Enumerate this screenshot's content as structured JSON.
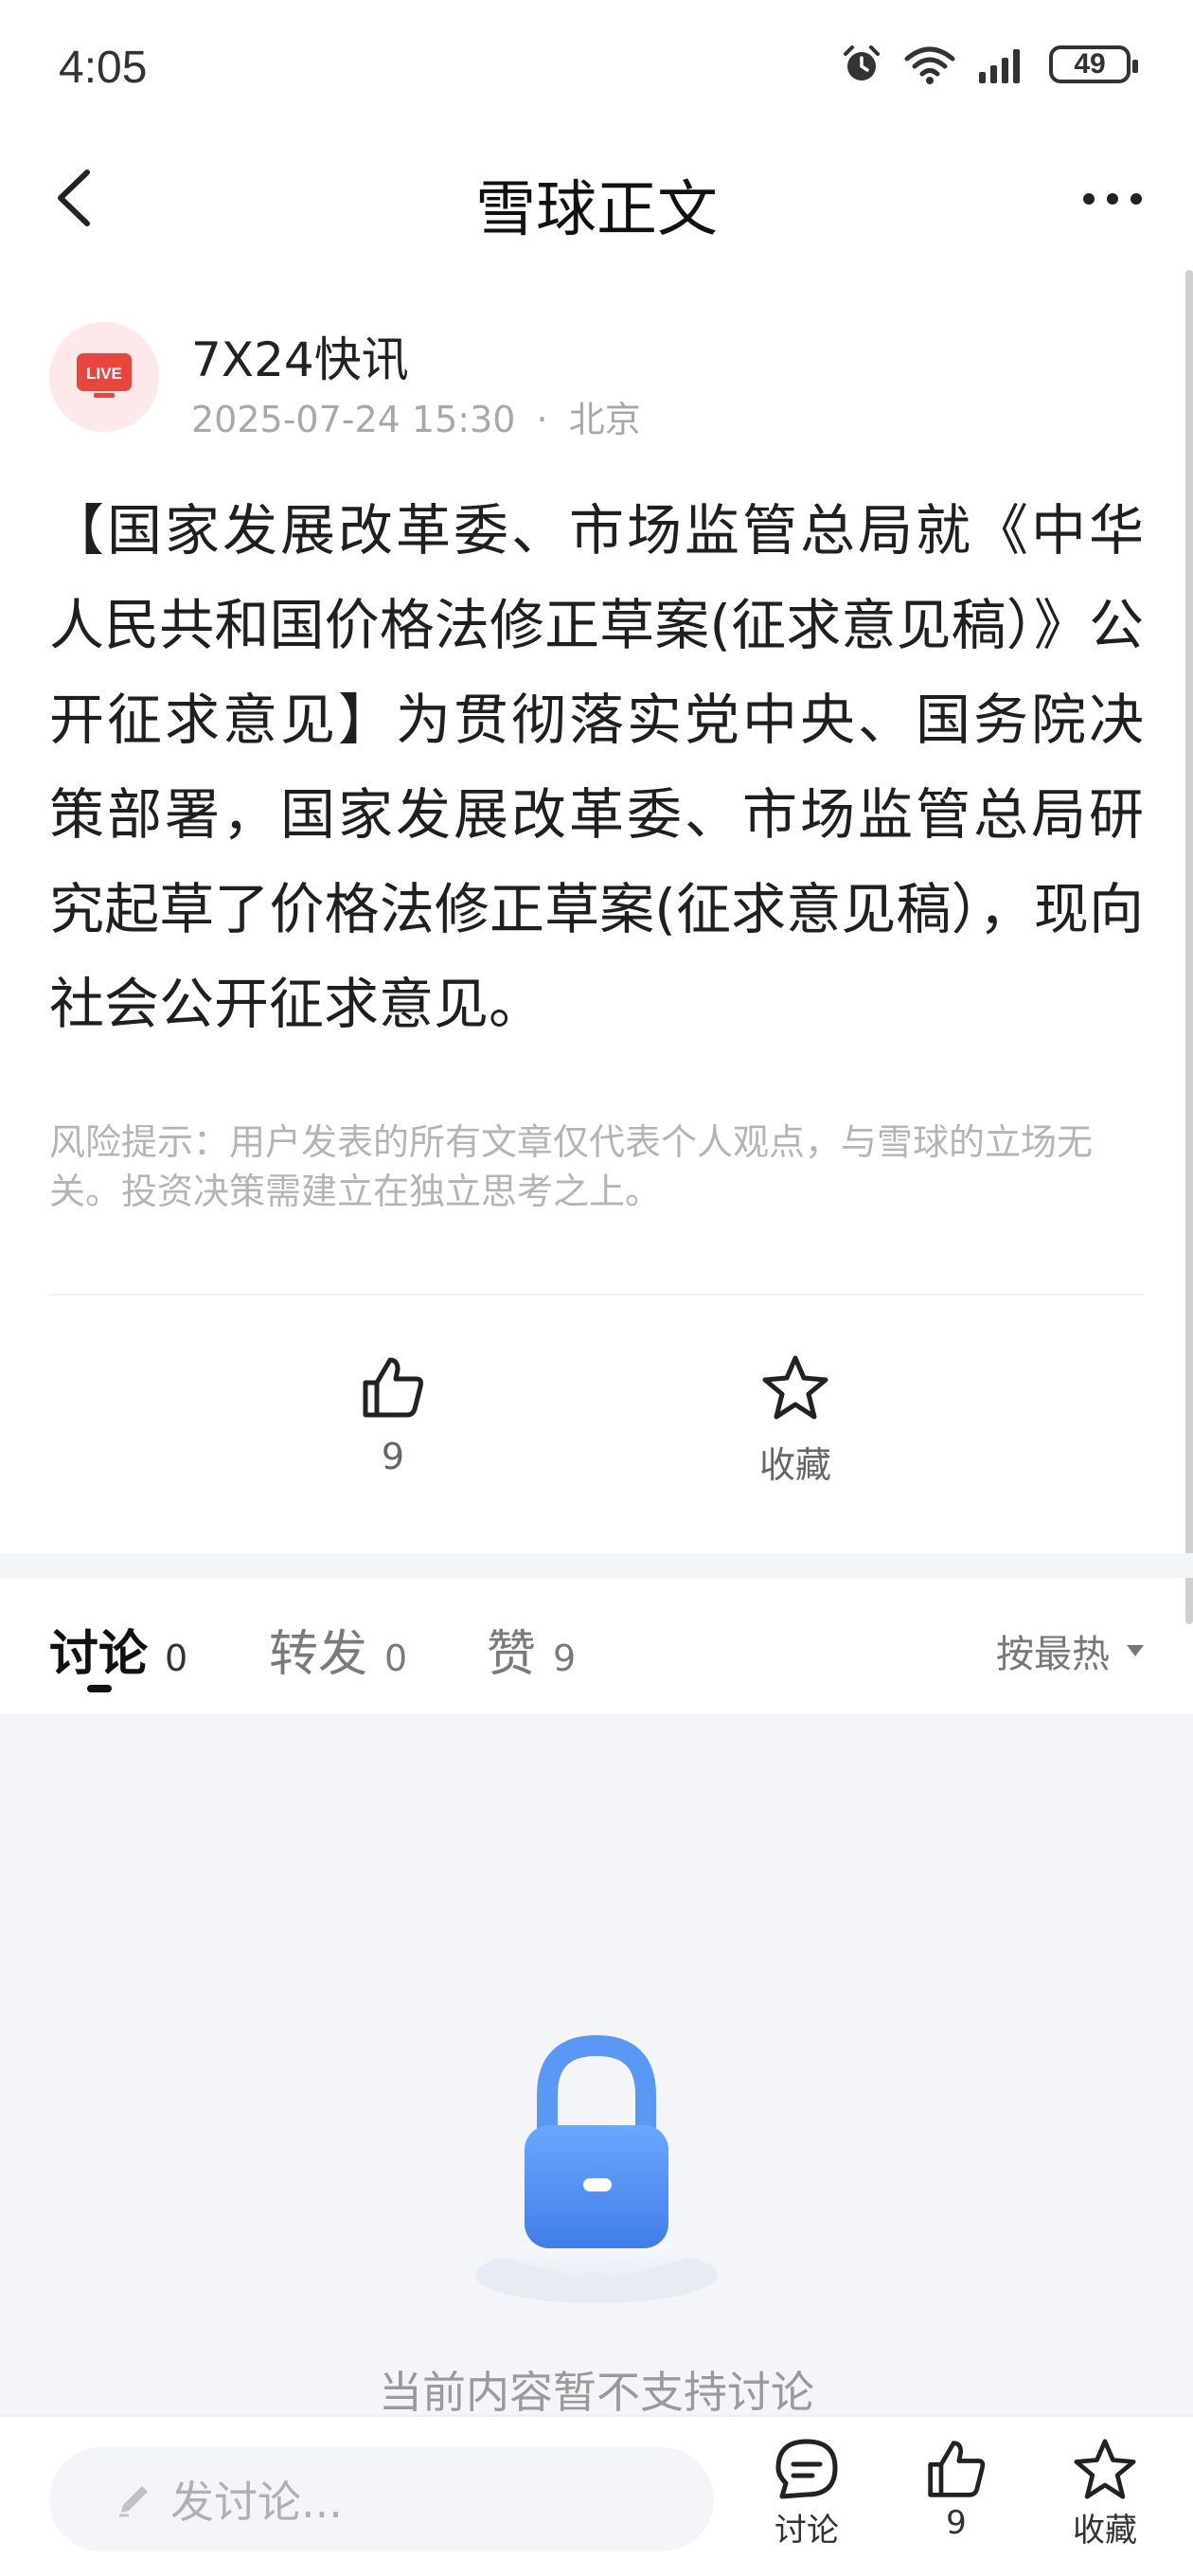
{
  "status_bar": {
    "time": "4:05",
    "battery": "49",
    "icons": [
      "alarm-icon",
      "wifi-icon",
      "signal-icon",
      "battery-icon"
    ]
  },
  "nav": {
    "title": "雪球正文",
    "back_icon": "back-arrow-icon",
    "more_icon": "more-icon"
  },
  "author": {
    "avatar_text": "LIVE",
    "name": "7X24快讯",
    "date": "2025-07-24 15:30",
    "separator": "·",
    "location": "北京"
  },
  "article": {
    "body": "【国家发展改革委、市场监管总局就《中华人民共和国价格法修正草案(征求意见稿）》公开征求意见】为贯彻落实党中央、国务院决策部署，国家发展改革委、市场监管总局研究起草了价格法修正草案(征求意见稿），现向社会公开征求意见。",
    "risk_note": "风险提示：用户发表的所有文章仅代表个人观点，与雪球的立场无关。投资决策需建立在独立思考之上。"
  },
  "actions": {
    "like_count": "9",
    "favorite_label": "收藏"
  },
  "tabs": [
    {
      "label": "讨论",
      "count": "0",
      "active": true
    },
    {
      "label": "转发",
      "count": "0",
      "active": false
    },
    {
      "label": "赞",
      "count": "9",
      "active": false
    }
  ],
  "sort": {
    "label": "按最热"
  },
  "empty_state": {
    "text": "当前内容暂不支持讨论"
  },
  "bottom_bar": {
    "input_placeholder": "发讨论...",
    "discuss_label": "讨论",
    "like_count": "9",
    "favorite_label": "收藏"
  },
  "colors": {
    "accent_red": "#e8453c",
    "lock_blue": "#4a8cf0",
    "text_primary": "#1f1f1f",
    "text_secondary": "#a8a8a8",
    "background_gray": "#f4f5f8"
  }
}
